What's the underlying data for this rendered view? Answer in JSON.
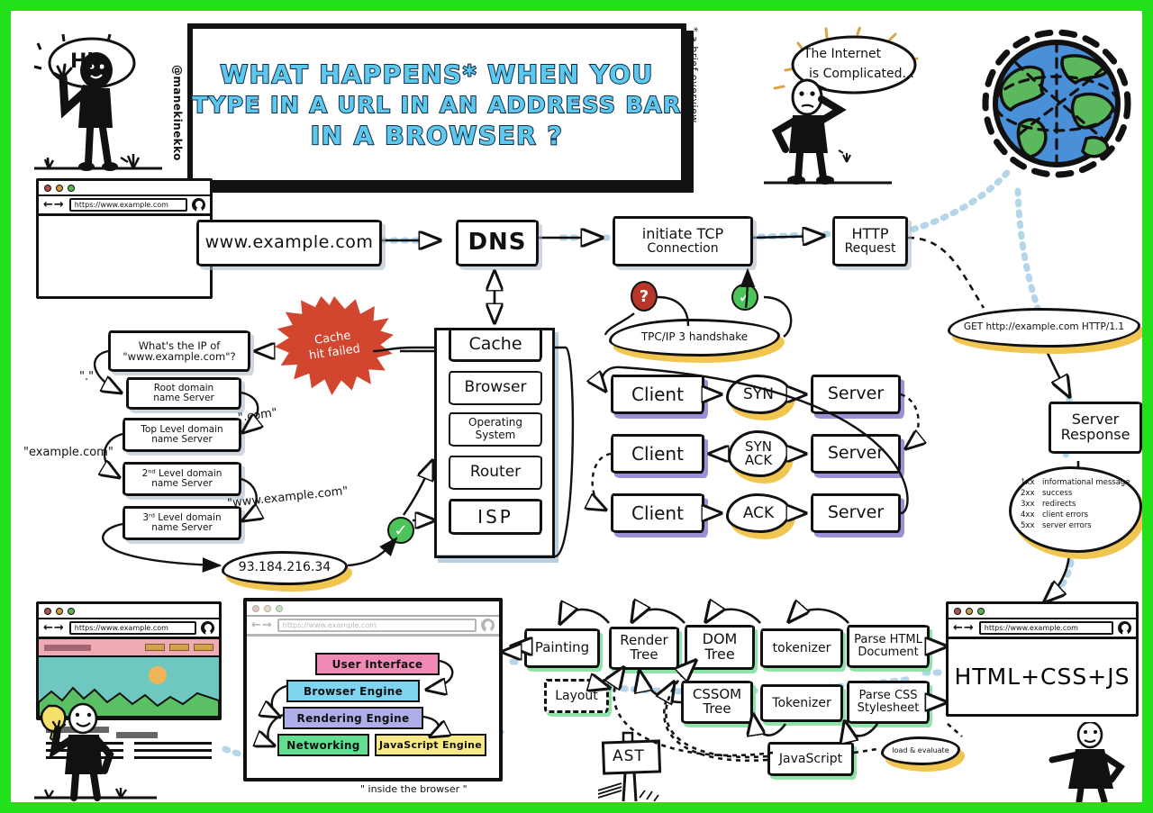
{
  "meta": {
    "signature": "@manekinekko",
    "footnote": "* a brief overview",
    "border_color": "#22e019"
  },
  "title": {
    "line1": "WHAT HAPPENS* WHEN YOU",
    "line2": "TYPE IN A URL IN AN ADDRESS BAR",
    "line3": "IN A BROWSER ?"
  },
  "characters": {
    "hi_bubble": "Hi!",
    "internet_bubble_line1": "The Internet",
    "internet_bubble_line2": "is Complicated..."
  },
  "browser_top": {
    "url": "https://www.example.com"
  },
  "flow": {
    "url_box": "www.example.com",
    "dns": "DNS",
    "tcp_line1": "initiate TCP",
    "tcp_line2": "Connection",
    "http_line1": "HTTP",
    "http_line2": "Request",
    "handshake_cloud": "TPC/IP 3 handshake",
    "badge_question": "?",
    "badge_check": "✓"
  },
  "cache": {
    "title": "Cache",
    "items": [
      "Browser",
      "Operating System",
      "Router",
      "ISP"
    ],
    "miss_line1": "Cache",
    "miss_line2": "hit failed"
  },
  "dns_chain": {
    "question_line1": "What's the IP of",
    "question_line2": "\"www.example.com\"?",
    "servers": [
      {
        "line1": "Root domain",
        "line2": "name Server"
      },
      {
        "line1": "Top Level domain",
        "line2": "name Server"
      },
      {
        "line1": "2ⁿᵈ Level domain",
        "line2": "name Server"
      },
      {
        "line1": "3ʳᵈ Level domain",
        "line2": "name Server"
      }
    ],
    "edge_labels": [
      "\".\"",
      "\".com\"",
      "\"example.com\"",
      "\"www.example.com\""
    ],
    "resolved_ip": "93.184.216.34"
  },
  "handshake": {
    "rows": [
      {
        "left": "Client",
        "mid": "SYN",
        "right": "Server"
      },
      {
        "left": "Client",
        "mid": "SYN ACK",
        "right": "Server"
      },
      {
        "left": "Client",
        "mid": "ACK",
        "right": "Server"
      }
    ],
    "mid_line1": [
      "SYN",
      "SYN",
      "ACK"
    ],
    "mid_line2": [
      "",
      "ACK",
      ""
    ]
  },
  "http": {
    "get_request": "GET http://example.com  HTTP/1.1",
    "server_response_line1": "Server",
    "server_response_line2": "Response",
    "status_codes": [
      {
        "code": "1xx",
        "desc": "informational message"
      },
      {
        "code": "2xx",
        "desc": "success"
      },
      {
        "code": "3xx",
        "desc": "redirects"
      },
      {
        "code": "4xx",
        "desc": "client errors"
      },
      {
        "code": "5xx",
        "desc": "server errors"
      }
    ]
  },
  "response_window": {
    "url": "https://www.example.com",
    "content": "HTML+CSS+JS"
  },
  "rendering": {
    "top_row": [
      {
        "line1": "Painting",
        "line2": ""
      },
      {
        "line1": "Render",
        "line2": "Tree"
      },
      {
        "line1": "DOM",
        "line2": "Tree"
      },
      {
        "line1": "tokenizer",
        "line2": ""
      },
      {
        "line1": "Parse HTML",
        "line2": "Document"
      }
    ],
    "bottom_row": [
      {
        "line1": "CSSOM",
        "line2": "Tree"
      },
      {
        "line1": "Tokenizer",
        "line2": ""
      },
      {
        "line1": "Parse CSS",
        "line2": "Stylesheet"
      }
    ],
    "layout": "Layout",
    "javascript": "JavaScript",
    "load_evaluate": "load & evaluate",
    "ast": "AST"
  },
  "browser_internals": {
    "caption": "\" inside the browser \"",
    "url": "https://www.example.com",
    "components": [
      {
        "label": "User Interface",
        "color": "#f08ab4"
      },
      {
        "label": "Browser Engine",
        "color": "#7fd4ef"
      },
      {
        "label": "Rendering Engine",
        "color": "#aeaeea"
      },
      {
        "label": "Networking",
        "color": "#63dd8f"
      },
      {
        "label": "JavaScript Engine",
        "color": "#f7ea86"
      }
    ]
  },
  "final_page": {
    "url": "https://www.example.com"
  },
  "colors": {
    "title_fill": "#5ec8ee",
    "title_stroke": "#0b2a44",
    "cache_miss": "#d2452f",
    "globe_ocean": "#4a90d9",
    "globe_land": "#5cb85c",
    "cloud_shadow": "#f0c651",
    "box_shadow_purple": "#9b8fd6",
    "box_shadow_green": "#8ee3a8",
    "connector_blue": "#a8cfe6"
  }
}
